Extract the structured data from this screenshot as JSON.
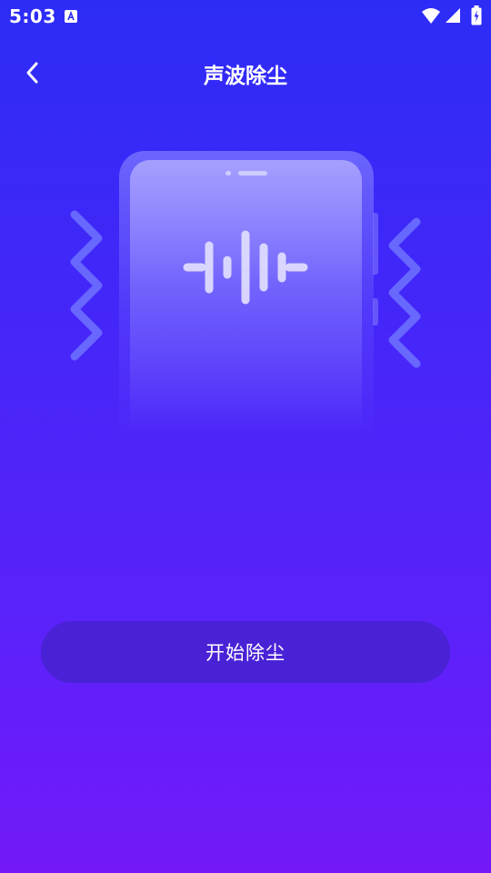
{
  "status_bar": {
    "time": "5:03",
    "icons": [
      "a-notification-icon",
      "wifi-icon",
      "signal-icon",
      "battery-icon"
    ]
  },
  "header": {
    "title": "声波除尘",
    "back_icon": "chevron-left-icon"
  },
  "illustration": {
    "icons": [
      "phone-icon",
      "sound-wave-icon",
      "vibration-zigzag-icon"
    ]
  },
  "actions": {
    "start_label": "开始除尘"
  },
  "colors": {
    "background_top": "#2d2cf7",
    "background_bottom": "#7318f9",
    "button_bg": "#4a22d6",
    "text": "#ffffff"
  }
}
